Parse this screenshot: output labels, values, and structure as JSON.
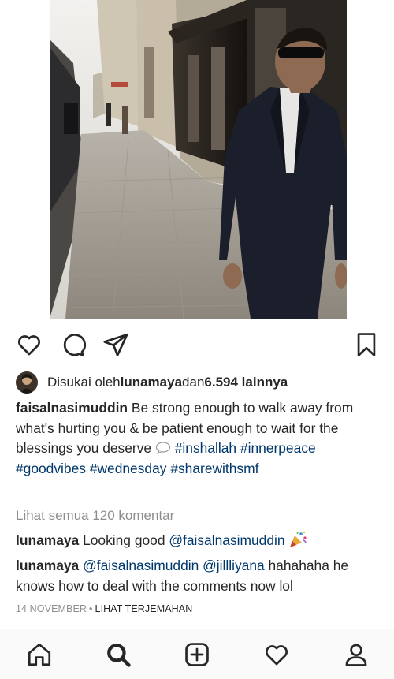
{
  "post": {
    "photo_icon": "street-photo-man-in-suit"
  },
  "actions": {
    "like_icon": "heart-outline-icon",
    "comment_icon": "comment-bubble-icon",
    "share_icon": "paper-plane-icon",
    "save_icon": "bookmark-icon"
  },
  "likes": {
    "prefix": "Disukai oleh ",
    "user": "lunamaya",
    "middle": " dan ",
    "count": "6.594 lainnya"
  },
  "caption": {
    "user": "faisalnasimuddin",
    "text": " Be strong enough to walk away from what's hurting you & be patient enough to wait for the blessings you deserve ",
    "emoji_icon": "speech-bubble-emoji",
    "hashtags": [
      "#inshallah",
      "#innerpeace",
      "#goodvibes",
      "#wednesday",
      "#sharewithsmf"
    ]
  },
  "view_all_comments": "Lihat semua 120 komentar",
  "comments": [
    {
      "user": "lunamaya",
      "text_before": " Looking good ",
      "mention": "@faisalnasimuddin",
      "emoji_icon": "party-popper-emoji"
    },
    {
      "user": "lunamaya",
      "mention1": "@faisalnasimuddin",
      "mention2": "@jillliyana",
      "text": " hahahaha he knows how to deal with the comments now lol"
    }
  ],
  "meta": {
    "date": "14 NOVEMBER",
    "separator": "•",
    "translate": "LIHAT TERJEMAHAN"
  },
  "bottom_nav": {
    "items": [
      "home-icon",
      "search-icon",
      "new-post-icon",
      "activity-heart-icon",
      "profile-icon"
    ]
  },
  "colors": {
    "text": "#262626",
    "link": "#00376b",
    "muted": "#8e8e8e",
    "nav_bg": "#fafafa"
  }
}
